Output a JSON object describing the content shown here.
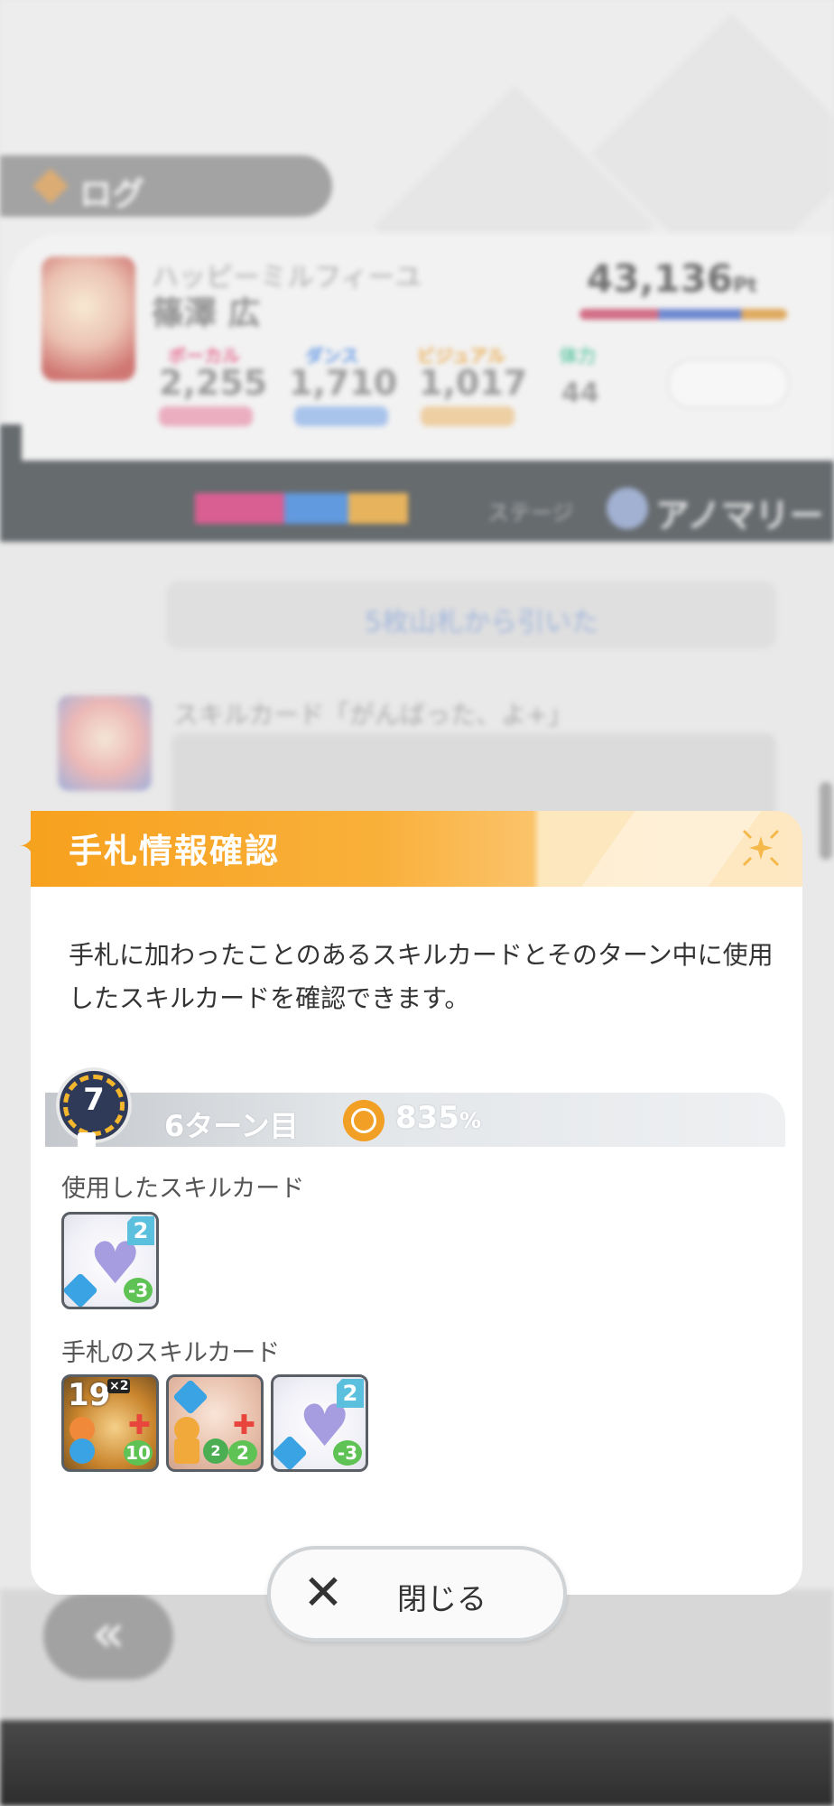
{
  "background": {
    "log_label": "ログ",
    "unit_name": "ハッピーミルフィーユ",
    "idol_name": "篠澤 広",
    "score": "43,136",
    "score_unit": "Pt",
    "stats": [
      {
        "label": "ボーカル",
        "value": "2,255",
        "color": "#e04b79"
      },
      {
        "label": "ダンス",
        "value": "1,710",
        "color": "#3d7fe0"
      },
      {
        "label": "ビジュアル",
        "value": "1,017",
        "color": "#e89b2f"
      },
      {
        "label": "体力",
        "value": "44",
        "color": "#4cbf9a"
      }
    ],
    "stage_label": "ステージ",
    "stage_title": "アノマリー",
    "action_text": "5枚山札から引いた",
    "skill_card_title": "スキルカード「がんばった、よ+」",
    "back_label": "«"
  },
  "modal": {
    "title": "手札情報確認",
    "description": "手札に加わったことのあるスキルカードとそのターン中に使用したスキルカードを確認できます。",
    "turn_badge": "7",
    "turn_label": "6ターン目",
    "rate_value": "835",
    "rate_unit": "%",
    "used_label": "使用したスキルカード",
    "hand_label": "手札のスキルカード",
    "used_cards": [
      {
        "cost": "2",
        "stamina": "-3",
        "icon": "heart-icon"
      }
    ],
    "hand_cards": [
      {
        "big_number": "19",
        "multiplier": "×2",
        "stamina": "10",
        "icon": "fire-icon"
      },
      {
        "cost_left": "2",
        "stamina": "2",
        "icon": "hand-icon"
      },
      {
        "cost": "2",
        "stamina": "-3",
        "icon": "heart-icon"
      }
    ],
    "close_label": "閉じる"
  }
}
